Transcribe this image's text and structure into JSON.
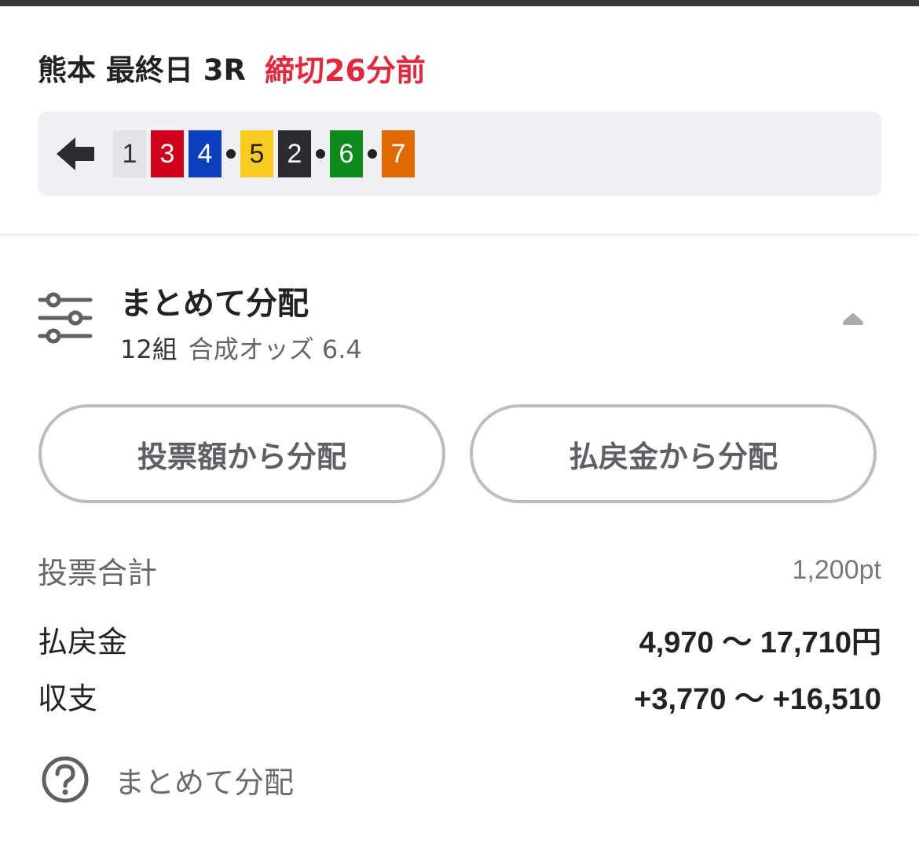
{
  "header": {
    "race_title": "熊本 最終日 3R",
    "deadline": "締切26分前",
    "deadline_color": "#e8253a"
  },
  "combination": {
    "back_icon": "arrow-left-icon",
    "numbers": [
      {
        "num": "1",
        "bg": "#e4e4e8",
        "fg": "#333333"
      },
      {
        "num": "3",
        "bg": "#d0021b",
        "fg": "#ffffff"
      },
      {
        "num": "4",
        "bg": "#0b3fbf",
        "fg": "#ffffff"
      },
      {
        "sep": true
      },
      {
        "num": "5",
        "bg": "#f7cc1e",
        "fg": "#222222"
      },
      {
        "num": "2",
        "bg": "#2b2b30",
        "fg": "#ffffff"
      },
      {
        "sep": true
      },
      {
        "num": "6",
        "bg": "#0f8a1c",
        "fg": "#ffffff"
      },
      {
        "sep": true
      },
      {
        "num": "7",
        "bg": "#e06a00",
        "fg": "#ffffff"
      }
    ]
  },
  "distribution": {
    "icon": "sliders-icon",
    "title": "まとめて分配",
    "count": "12組",
    "odds": "合成オッズ 6.4",
    "collapse_icon": "chevron-up-icon"
  },
  "buttons": {
    "by_bet": "投票額から分配",
    "by_payout": "払戻金から分配"
  },
  "summary": {
    "total_label": "投票合計",
    "total_value": "1,200pt",
    "payout_label": "払戻金",
    "payout_value": "4,970 〜 17,710円",
    "balance_label": "収支",
    "balance_value": "+3,770 〜 +16,510"
  },
  "help": {
    "icon": "question-circle-icon",
    "label": "まとめて分配"
  }
}
